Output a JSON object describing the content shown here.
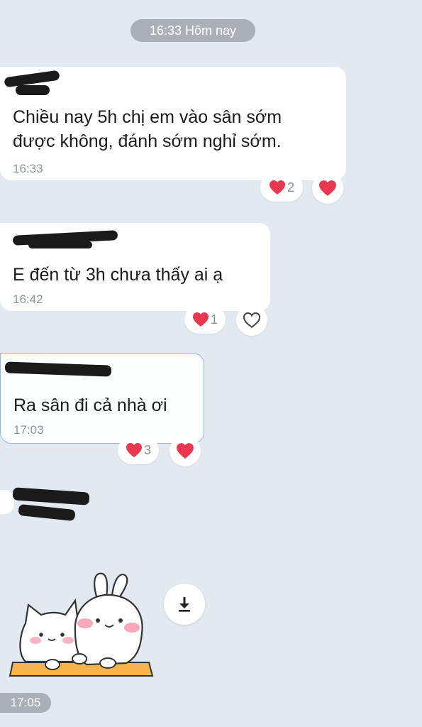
{
  "header": {
    "date_label": "16:33 Hôm nay"
  },
  "messages": [
    {
      "text": "Chiều nay 5h chị em vào sân sớm\nđược không, đánh sớm nghỉ sớm.",
      "time": "16:33",
      "reaction_count": "2"
    },
    {
      "text": "E đến từ 3h chưa thấy ai ạ",
      "time": "16:42",
      "reaction_count": "1"
    },
    {
      "text": "Ra sân đi cả nhà ơi",
      "time": "17:03",
      "reaction_count": "3"
    }
  ],
  "sticker": {
    "time": "17:05",
    "icon": "download-icon"
  },
  "colors": {
    "background": "#e2e9f1",
    "heart": "#e8384f",
    "pill": "#a9b0b8"
  }
}
